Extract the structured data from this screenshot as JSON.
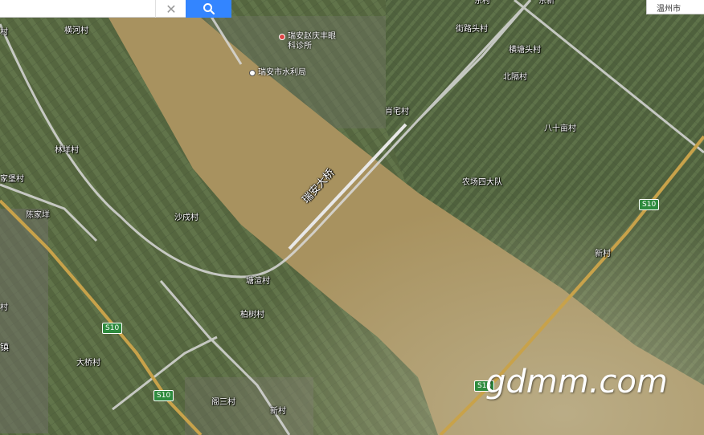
{
  "search": {
    "clear_icon": "close-icon",
    "search_icon": "search-icon"
  },
  "city": {
    "label": "温州市"
  },
  "pois": {
    "clinic": "瑞安赵庆丰眼科诊所",
    "water_bureau": "瑞安市水利局"
  },
  "bridge": {
    "label": "瑞安大桥"
  },
  "villages": {
    "v1": "横河村",
    "v2": "街路头村",
    "v3": "横塘头村",
    "v4": "北隔村",
    "v5": "肖宅村",
    "v6": "八十亩村",
    "v7": "林垟村",
    "v8": "家堡村",
    "v9": "农场四大队",
    "v10": "陈家垟",
    "v11": "沙戍村",
    "v12": "新村",
    "v13": "塘渲村",
    "v14": "村",
    "v15": "柏树村",
    "v16": "镇",
    "v17": "大桥村",
    "v18": "阁三村",
    "v19": "新村",
    "v20": "村",
    "v21": "东村",
    "v22": "东新"
  },
  "roads": {
    "s10": "S10"
  },
  "watermark": "gdmm.com",
  "colors": {
    "river": "#a8925f",
    "land": "#5b6b46",
    "road_white": "#d9d9d9",
    "road_yellow": "#c8a24a",
    "search_blue": "#3385ff"
  }
}
